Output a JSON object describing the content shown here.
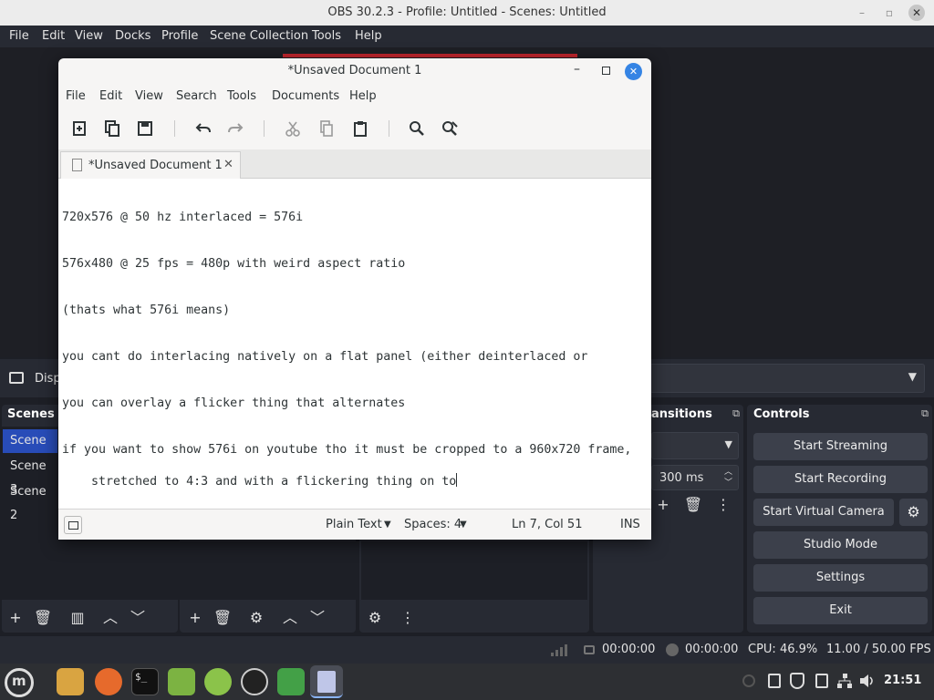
{
  "obs": {
    "title": "OBS 30.2.3 - Profile: Untitled - Scenes: Untitled",
    "menu": [
      "File",
      "Edit",
      "View",
      "Docks",
      "Profile",
      "Scene Collection",
      "Tools",
      "Help"
    ],
    "source_label": "Disp",
    "docks": {
      "scenes_title": "Scenes",
      "scenes": [
        "Scene",
        "Scene 3",
        "Scene 2"
      ],
      "transitions_title": "ansitions",
      "duration": "300 ms",
      "controls_title": "Controls"
    },
    "controls": {
      "start_streaming": "Start Streaming",
      "start_recording": "Start Recording",
      "start_virtual_camera": "Start Virtual Camera",
      "studio_mode": "Studio Mode",
      "settings": "Settings",
      "exit": "Exit"
    },
    "status": {
      "stream_time": "00:00:00",
      "record_time": "00:00:00",
      "cpu": "CPU: 46.9%",
      "fps": "11.00 / 50.00 FPS"
    },
    "accent_color": "#284cb8"
  },
  "editor": {
    "title": "*Unsaved Document 1",
    "menu": [
      "File",
      "Edit",
      "View",
      "Search",
      "Tools",
      "Documents",
      "Help"
    ],
    "tab_label": "*Unsaved Document 1",
    "lines": [
      "720x576 @ 50 hz interlaced = 576i",
      "576x480 @ 25 fps = 480p with weird aspect ratio",
      "(thats what 576i means)",
      "you cant do interlacing natively on a flat panel (either deinterlaced or",
      "you can overlay a flicker thing that alternates",
      "if you want to show 576i on youtube tho it must be cropped to a 960x720 frame,",
      "stretched to 4:3 and with a flickering thing on to"
    ],
    "status": {
      "syntax": "Plain Text",
      "spaces": "Spaces: 4",
      "position": "Ln 7, Col 51",
      "mode": "INS"
    }
  },
  "taskbar": {
    "clock": "21:51"
  }
}
